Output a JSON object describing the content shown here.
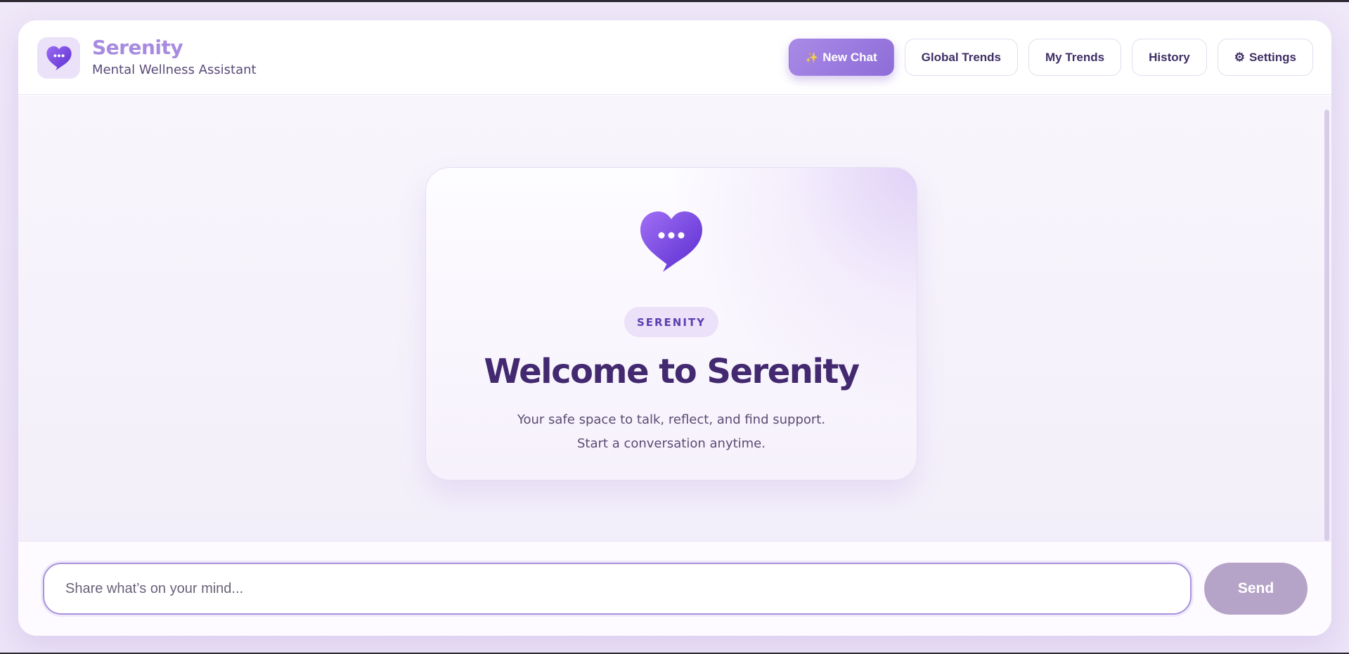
{
  "brand": {
    "title": "Serenity",
    "subtitle": "Mental Wellness Assistant"
  },
  "nav": {
    "new_chat": "New Chat",
    "new_chat_icon": "sparkle-icon",
    "global_trends": "Global Trends",
    "my_trends": "My Trends",
    "history": "History",
    "settings": "Settings",
    "settings_icon": "⚙"
  },
  "hero": {
    "badge": "SERENITY",
    "title": "Welcome to Serenity",
    "line1": "Your safe space to talk, reflect, and find support.",
    "line2": "Start a conversation anytime."
  },
  "composer": {
    "placeholder": "Share what’s on your mind...",
    "value": "",
    "send_label": "Send"
  },
  "colors": {
    "accent": "#8e6dd8",
    "brand_text": "#a78be0",
    "heading": "#43296f",
    "send_disabled": "#b5a4c8"
  }
}
